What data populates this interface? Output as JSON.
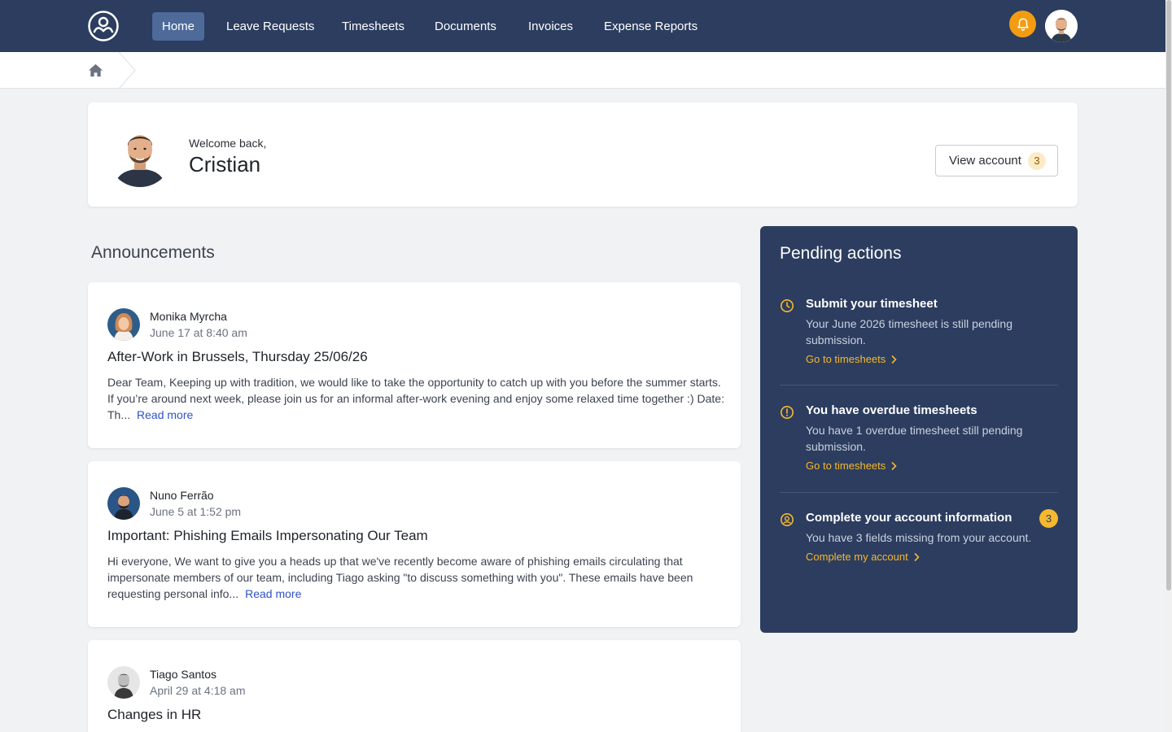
{
  "nav": {
    "items": [
      {
        "label": "Home",
        "active": true
      },
      {
        "label": "Leave Requests"
      },
      {
        "label": "Timesheets"
      },
      {
        "label": "Documents"
      },
      {
        "label": "Invoices"
      },
      {
        "label": "Expense Reports"
      }
    ],
    "accent_color": "#f39c12",
    "bg_color": "#2c3d5f"
  },
  "welcome": {
    "label": "Welcome back,",
    "name": "Cristian",
    "view_account_label": "View account",
    "view_account_count": "3"
  },
  "announcements": {
    "title": "Announcements",
    "items": [
      {
        "author": "Monika Myrcha",
        "date": "June 17 at 8:40 am",
        "headline": "After-Work in Brussels, Thursday 25/06/26",
        "body": "Dear Team, Keeping up with tradition, we would like to take the opportunity to catch up with you before the summer starts. If you’re around next week, please join us for an informal after-work evening and enjoy some relaxed time together :) Date: Th...",
        "read_more": "Read more"
      },
      {
        "author": "Nuno Ferrão",
        "date": "June 5 at 1:52 pm",
        "headline": "Important: Phishing Emails Impersonating Our Team",
        "body": "Hi everyone, We want to give you a heads up that we've recently become aware of phishing emails circulating that impersonate members of our team, including Tiago asking \"to discuss something with you\". These emails have been requesting personal info...",
        "read_more": "Read more"
      },
      {
        "author": "Tiago Santos",
        "date": "April 29 at 4:18 am",
        "headline": "Changes in HR"
      }
    ]
  },
  "pending": {
    "title": "Pending actions",
    "items": [
      {
        "icon": "clock-icon",
        "title": "Submit your timesheet",
        "desc": "Your June 2026 timesheet is still pending submission.",
        "link": "Go to timesheets"
      },
      {
        "icon": "alert-circle-icon",
        "title": "You have overdue timesheets",
        "desc": "You have 1 overdue timesheet still pending submission.",
        "link": "Go to timesheets"
      },
      {
        "icon": "user-circle-icon",
        "title": "Complete your account information",
        "desc": "You have 3 fields missing from your account.",
        "link": "Complete my account",
        "badge": "3"
      }
    ]
  }
}
